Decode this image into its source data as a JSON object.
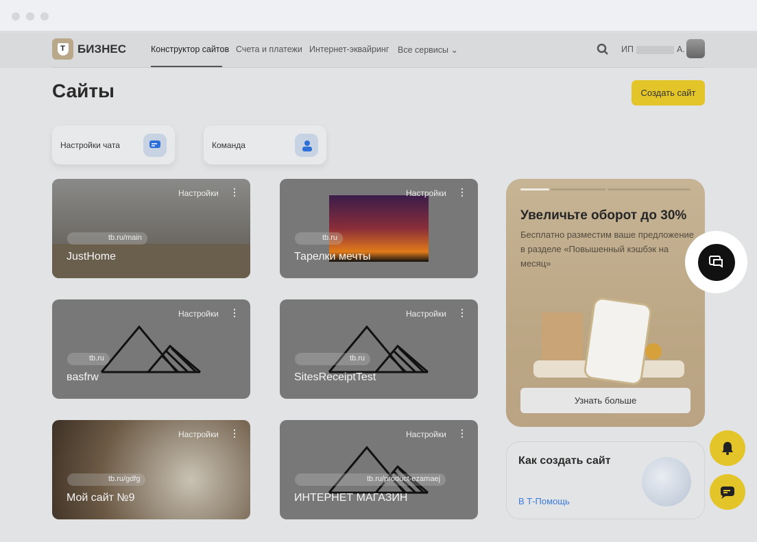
{
  "nav": {
    "brand": "БИЗНЕС",
    "logo_letter": "Т",
    "items": [
      "Конструктор сайтов",
      "Счета и платежи",
      "Интернет-эквайринг",
      "Все сервисы"
    ],
    "user_prefix": "ИП",
    "user_suffix": "А."
  },
  "page": {
    "title": "Сайты",
    "create_button": "Создать сайт"
  },
  "quick": [
    {
      "label": "Настройки чата"
    },
    {
      "label": "Команда"
    }
  ],
  "settings_label": "Настройки",
  "sites": [
    {
      "name": "JustHome",
      "url": "tb.ru/main"
    },
    {
      "name": "Тарелки мечты",
      "url": "tb.ru"
    },
    {
      "name": "вasfrw",
      "url": "tb.ru"
    },
    {
      "name": "SitesReceiptTest",
      "url": "tb.ru"
    },
    {
      "name": "Мой сайт №9",
      "url": "tb.ru/gdfg"
    },
    {
      "name": "ИНТЕРНЕТ МАГАЗИН",
      "url": "tb.ru/product-ezamaej"
    }
  ],
  "promo": {
    "title": "Увеличьте оборот до 30%",
    "text": "Бесплатно разместим ваше предложение в разделе «Повышенный кэшбэк на месяц»",
    "button": "Узнать больше",
    "slide_progress": 0.25
  },
  "help": {
    "title": "Как создать сайт",
    "link": "В Т-Помощь"
  }
}
